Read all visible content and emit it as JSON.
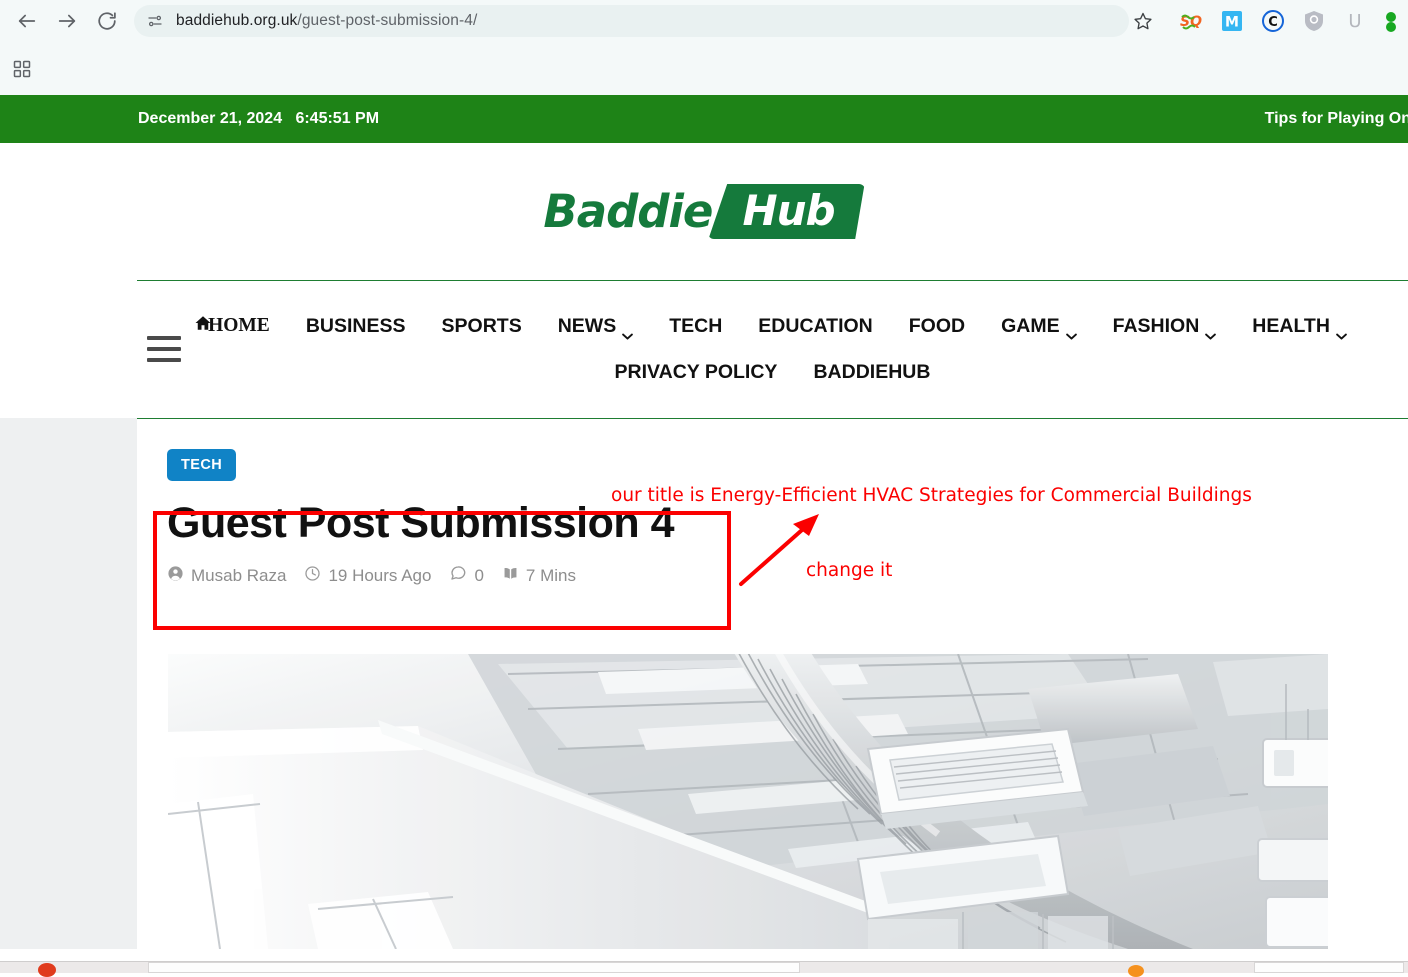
{
  "browser": {
    "url_domain": "baddiehub.org.uk",
    "url_path": "/guest-post-submission-4/",
    "back_label": "Back",
    "forward_label": "Forward",
    "reload_label": "Reload",
    "site_info_label": "View site information",
    "bookmark_label": "Bookmark this tab",
    "extensions": [
      {
        "name": "sq-extension-icon",
        "label": "SQ"
      },
      {
        "name": "m-extension-icon",
        "label": "M"
      },
      {
        "name": "c-extension-icon",
        "label": "C"
      },
      {
        "name": "shield-extension-icon",
        "label": "Shield"
      },
      {
        "name": "u-extension-icon",
        "label": "U"
      },
      {
        "name": "green-extension-icon",
        "label": "G"
      }
    ],
    "apps_label": "Apps"
  },
  "topbar": {
    "date": "December 21, 2024",
    "time": "6:45:51 PM",
    "ticker": "Tips for Playing On"
  },
  "header": {
    "logo_word": "Baddie",
    "logo_badge": "Hub",
    "menu_toggle_label": "Menu"
  },
  "nav": {
    "row1": [
      {
        "label": "HOME",
        "icon": "home-icon",
        "dropdown": false
      },
      {
        "label": "BUSINESS",
        "dropdown": false
      },
      {
        "label": "SPORTS",
        "dropdown": false
      },
      {
        "label": "NEWS",
        "dropdown": true
      },
      {
        "label": "TECH",
        "dropdown": false
      },
      {
        "label": "EDUCATION",
        "dropdown": false
      },
      {
        "label": "FOOD",
        "dropdown": false
      },
      {
        "label": "GAME",
        "dropdown": true
      },
      {
        "label": "FASHION",
        "dropdown": true
      },
      {
        "label": "HEALTH",
        "dropdown": true
      }
    ],
    "row2": [
      {
        "label": "PRIVACY POLICY",
        "dropdown": false
      },
      {
        "label": "BADDIEHUB",
        "dropdown": false
      }
    ]
  },
  "article": {
    "category": "TECH",
    "title": "Guest Post Submission 4",
    "author": "Musab Raza",
    "published": "19 Hours Ago",
    "comments": "0",
    "read_time": "7 Mins",
    "image_alt": "Commercial building ceiling with HVAC ductwork and air conditioning units"
  },
  "annotations": {
    "title_note": "our title is  Energy-Efficient HVAC Strategies for Commercial Buildings",
    "change_note": "change it",
    "color": "#fb0000"
  },
  "colors": {
    "brand_green": "#1e8317",
    "logo_green": "#157a3c",
    "badge_blue": "#1083c6",
    "annotation_red": "#fb0000",
    "page_bg": "#eef0f1"
  }
}
